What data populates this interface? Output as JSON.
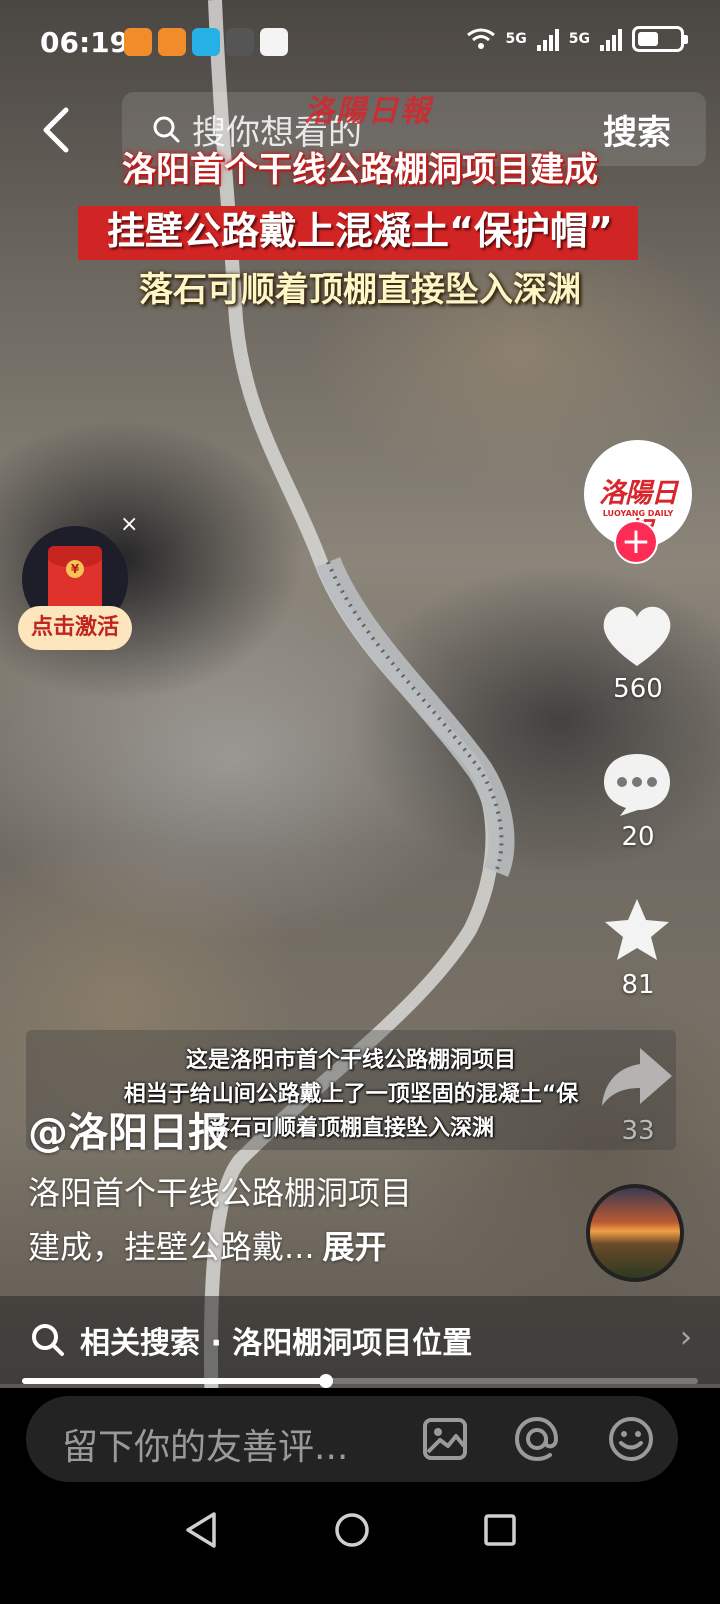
{
  "status_bar": {
    "time": "06:19",
    "network_1": "5G",
    "network_2": "5G",
    "battery_level": 0.5
  },
  "top_bar": {
    "search_placeholder": "搜你想看的",
    "search_button": "搜索"
  },
  "video": {
    "watermark": "洛陽日報",
    "headline_1": "洛阳首个干线公路棚洞项目建成",
    "headline_2": "挂壁公路戴上混凝土“保护帽”",
    "headline_3": "落石可顺着顶棚直接坠入深渊",
    "subtitles": [
      "这是洛阳市首个干线公路棚洞项目",
      "相当于给山间公路戴上了一顶坚固的混凝土“保",
      "落石可顺着顶棚直接坠入深渊"
    ],
    "progress": 0.45
  },
  "red_packet": {
    "label": "点击激活",
    "close": "×",
    "coin": "¥"
  },
  "right_rail": {
    "avatar_logo": "洛陽日報",
    "avatar_sub": "LUOYANG DAILY",
    "follow": "+",
    "likes": "560",
    "comments": "20",
    "favorites": "81",
    "shares": "33"
  },
  "post": {
    "author": "@洛阳日报",
    "desc_line_1": "洛阳首个干线公路棚洞项目",
    "desc_line_2": "建成，挂壁公路戴...",
    "expand": "展开"
  },
  "related_search": {
    "text": "相关搜索 · 洛阳棚洞项目位置",
    "chevron": "›"
  },
  "comment_bar": {
    "placeholder": "留下你的友善评..."
  },
  "colors": {
    "accent_red": "#fe2c55",
    "brand_red": "#d8262c"
  }
}
